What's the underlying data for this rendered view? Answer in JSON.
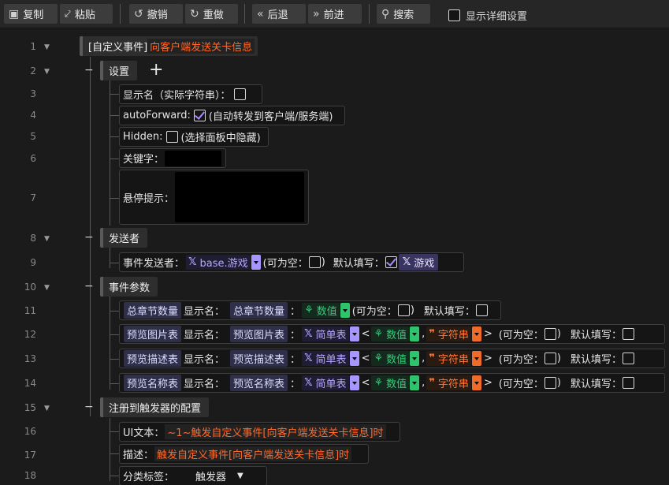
{
  "toolbar": {
    "copy": "复制",
    "paste": "粘贴",
    "undo": "撤销",
    "redo": "重做",
    "back": "后退",
    "forward": "前进",
    "search": "搜索",
    "show_detail": "显示详细设置"
  },
  "lines": [
    "1",
    "2",
    "3",
    "4",
    "5",
    "6",
    "7",
    "8",
    "9",
    "10",
    "11",
    "12",
    "13",
    "14",
    "15",
    "16",
    "17",
    "18"
  ],
  "event": {
    "prefix": "[自定义事件]",
    "name": "向客户端发送关卡信息"
  },
  "settings": {
    "header": "设置",
    "add": "+",
    "display_name_label": "显示名（实际字符串）：",
    "auto_forward_label": "autoForward:",
    "auto_forward_note": "(自动转发到客户端/服务端)",
    "hidden_label": "Hidden:",
    "hidden_note": "(选择面板中隐藏)",
    "keyword_label": "关键字：",
    "tooltip_label": "悬停提示："
  },
  "sender": {
    "header": "发送者",
    "label": "事件发送者：",
    "type": "base.游戏",
    "nullable": "(可为空：",
    "nullable_close": ")",
    "default": "默认填写：",
    "default_value": "游戏"
  },
  "params": {
    "header": "事件参数",
    "display_label": "显示名：",
    "nullable": "(可为空：",
    "nullable_close": ")",
    "default": "默认填写：",
    "simple_table": "简单表",
    "number": "数值",
    "string": "字符串",
    "lt": "<",
    "gt": ">",
    "comma": ",",
    "colon": "：",
    "rows": [
      {
        "key": "总章节数量",
        "name": "总章节数量"
      },
      {
        "key": "预览图片表",
        "name": "预览图片表"
      },
      {
        "key": "预览描述表",
        "name": "预览描述表"
      },
      {
        "key": "预览名称表",
        "name": "预览名称表"
      }
    ]
  },
  "register": {
    "header": "注册到触发器的配置",
    "ui_text_label": "UI文本：",
    "ui_text_value": "~1~触发自定义事件[向客户端发送关卡信息]时",
    "desc_label": "描述：",
    "desc_value": "触发自定义事件[向客户端发送关卡信息]时",
    "category_label": "分类标签：",
    "category_value": "触发器"
  },
  "colors": {
    "accent_orange": "#ff6a2a",
    "accent_purple": "#a796ff",
    "accent_green": "#2ec46b"
  }
}
